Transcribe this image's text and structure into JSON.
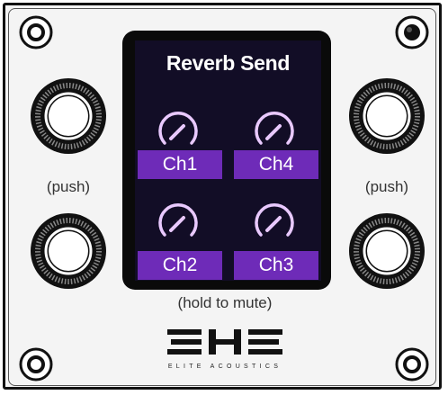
{
  "device": {
    "screen_title": "Reverb Send",
    "channels": [
      {
        "label": "Ch1"
      },
      {
        "label": "Ch4"
      },
      {
        "label": "Ch2"
      },
      {
        "label": "Ch3"
      }
    ],
    "left_knob_label": "(push)",
    "right_knob_label": "(push)",
    "screen_hint": "(hold to mute)",
    "brand_name": "ELITE ACOUSTICS",
    "logo_text": "EAE"
  },
  "colors": {
    "panel": "#f4f4f4",
    "screen_bg": "#120d26",
    "accent_purple": "#6e2bb8",
    "knob_arc": "#e9c9ff"
  },
  "icons": [
    "screw-icon",
    "rotary-encoder-icon",
    "send-level-knob-icon",
    "elite-acoustics-logo"
  ]
}
